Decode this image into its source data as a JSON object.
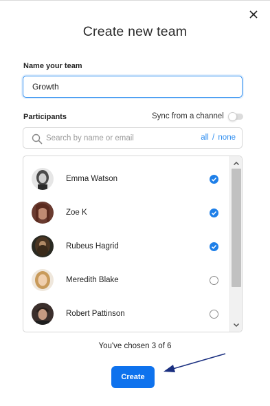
{
  "dialog": {
    "title": "Create new team"
  },
  "team_name": {
    "label": "Name your team",
    "value": "Growth"
  },
  "participants": {
    "label": "Participants",
    "sync_label": "Sync from a channel",
    "sync_enabled": false,
    "search_placeholder": "Search by name or email",
    "select_all": "all",
    "separator": "/",
    "select_none": "none",
    "items": [
      {
        "name": "Emma Watson",
        "checked": true,
        "avatar_color": "#8a8a8a"
      },
      {
        "name": "Zoe K",
        "checked": true,
        "avatar_color": "#8b5a4a"
      },
      {
        "name": "Rubeus Hagrid",
        "checked": true,
        "avatar_color": "#4a3a2a"
      },
      {
        "name": "Meredith Blake",
        "checked": false,
        "avatar_color": "#c9a46a"
      },
      {
        "name": "Robert Pattinson",
        "checked": false,
        "avatar_color": "#5a4a44"
      }
    ]
  },
  "summary": {
    "chosen_text": "You've chosen 3 of 6"
  },
  "actions": {
    "create_label": "Create"
  },
  "colors": {
    "accent": "#0e72ed",
    "check_on": "#1e7fe8",
    "link": "#2f8ef0",
    "annotation_arrow": "#1a2f80"
  }
}
